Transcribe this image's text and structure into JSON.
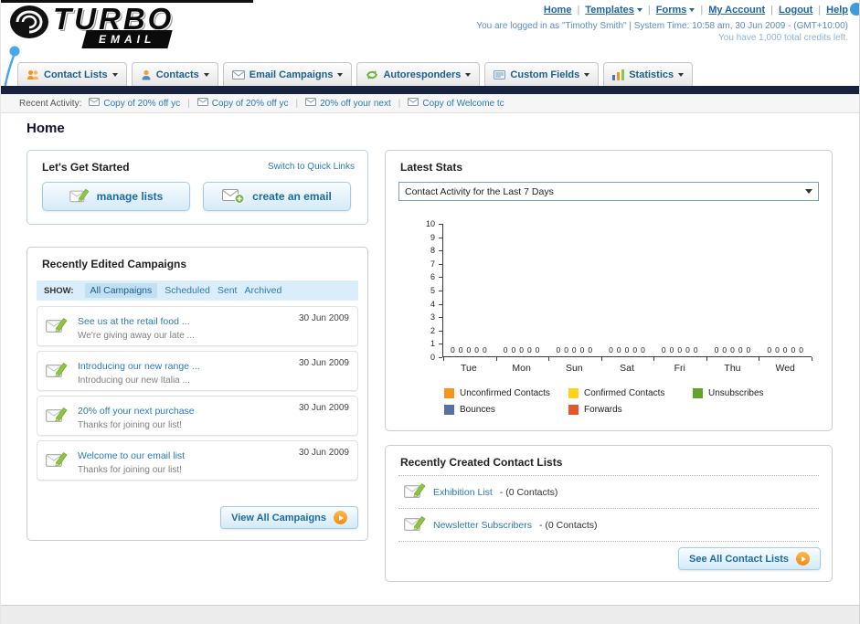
{
  "header": {
    "logo": {
      "primary": "TURBO",
      "secondary": "EMAIL"
    },
    "nav_links": [
      {
        "label": "Home",
        "dropdown": false
      },
      {
        "label": "Templates",
        "dropdown": true
      },
      {
        "label": "Forms",
        "dropdown": true
      },
      {
        "label": "My Account",
        "dropdown": false
      },
      {
        "label": "Logout",
        "dropdown": false
      },
      {
        "label": "Help",
        "dropdown": false
      }
    ],
    "login_info": "You are logged in as \"Timothy Smith\" | System Time: 10:58 am, 30 Jun 2009 - (GMT+10:00)",
    "credits_info": "You have 1,000 total credits left."
  },
  "nav": {
    "tabs": [
      {
        "id": "contact-lists",
        "label": "Contact Lists"
      },
      {
        "id": "contacts",
        "label": "Contacts"
      },
      {
        "id": "email-campaigns",
        "label": "Email Campaigns"
      },
      {
        "id": "autoresponders",
        "label": "Autoresponders"
      },
      {
        "id": "custom-fields",
        "label": "Custom Fields"
      },
      {
        "id": "statistics",
        "label": "Statistics"
      }
    ]
  },
  "recent_activity": {
    "label": "Recent Activity:",
    "items": [
      "Copy of 20% off yc",
      "Copy of 20% off yc",
      "20% off your next",
      "Copy of Welcome tc"
    ]
  },
  "page_title": "Home",
  "get_started": {
    "title": "Let's Get Started",
    "switch_link": "Switch to Quick Links",
    "buttons": [
      {
        "label": "manage lists"
      },
      {
        "label": "create an email"
      }
    ]
  },
  "campaigns": {
    "title": "Recently Edited Campaigns",
    "show_label": "SHOW:",
    "filters": [
      "All Campaigns",
      "Scheduled",
      "Sent",
      "Archived"
    ],
    "active_filter": "All Campaigns",
    "items": [
      {
        "title": "See us at the retail food ...",
        "subtitle": "We're giving away our late ...",
        "date": "30 Jun 2009"
      },
      {
        "title": "Introducing our new range ...",
        "subtitle": "Introducing our new Italia ...",
        "date": "30 Jun 2009"
      },
      {
        "title": "20% off your next purchase",
        "subtitle": "Thanks for joining our list!",
        "date": "30 Jun 2009"
      },
      {
        "title": "Welcome to our email list",
        "subtitle": "Thanks for joining our list!",
        "date": "30 Jun 2009"
      }
    ],
    "view_all_label": "View All Campaigns"
  },
  "latest_stats": {
    "title": "Latest Stats",
    "dropdown_value": "Contact Activity for the Last 7 Days",
    "chart_data": {
      "type": "bar",
      "categories": [
        "Tue",
        "Mon",
        "Sun",
        "Sat",
        "Fri",
        "Thu",
        "Wed"
      ],
      "series": [
        {
          "name": "Unconfirmed Contacts",
          "color": "#f7941d",
          "values": [
            0,
            0,
            0,
            0,
            0,
            0,
            0
          ]
        },
        {
          "name": "Confirmed Contacts",
          "color": "#ffd21e",
          "values": [
            0,
            0,
            0,
            0,
            0,
            0,
            0
          ]
        },
        {
          "name": "Unsubscribes",
          "color": "#61a32a",
          "values": [
            0,
            0,
            0,
            0,
            0,
            0,
            0
          ]
        },
        {
          "name": "Bounces",
          "color": "#5470a5",
          "values": [
            0,
            0,
            0,
            0,
            0,
            0,
            0
          ]
        },
        {
          "name": "Forwards",
          "color": "#e2572b",
          "values": [
            0,
            0,
            0,
            0,
            0,
            0,
            0
          ]
        }
      ],
      "title": "",
      "xlabel": "",
      "ylabel": "",
      "ylim": [
        0,
        10
      ],
      "yticks": [
        0,
        1,
        2,
        3,
        4,
        5,
        6,
        7,
        8,
        9,
        10
      ],
      "grid": false,
      "legend_position": "bottom"
    },
    "legend": [
      {
        "label": "Unconfirmed Contacts",
        "color": "#f7941d"
      },
      {
        "label": "Confirmed Contacts",
        "color": "#ffd21e"
      },
      {
        "label": "Unsubscribes",
        "color": "#61a32a"
      },
      {
        "label": "Bounces",
        "color": "#5470a5"
      },
      {
        "label": "Forwards",
        "color": "#e2572b"
      }
    ]
  },
  "contact_lists": {
    "title": "Recently Created Contact Lists",
    "items": [
      {
        "name": "Exhibition List",
        "suffix": "- (0 Contacts)"
      },
      {
        "name": "Newsletter Subscribers",
        "suffix": "- (0 Contacts)"
      }
    ],
    "see_all_label": "See All Contact Lists"
  }
}
